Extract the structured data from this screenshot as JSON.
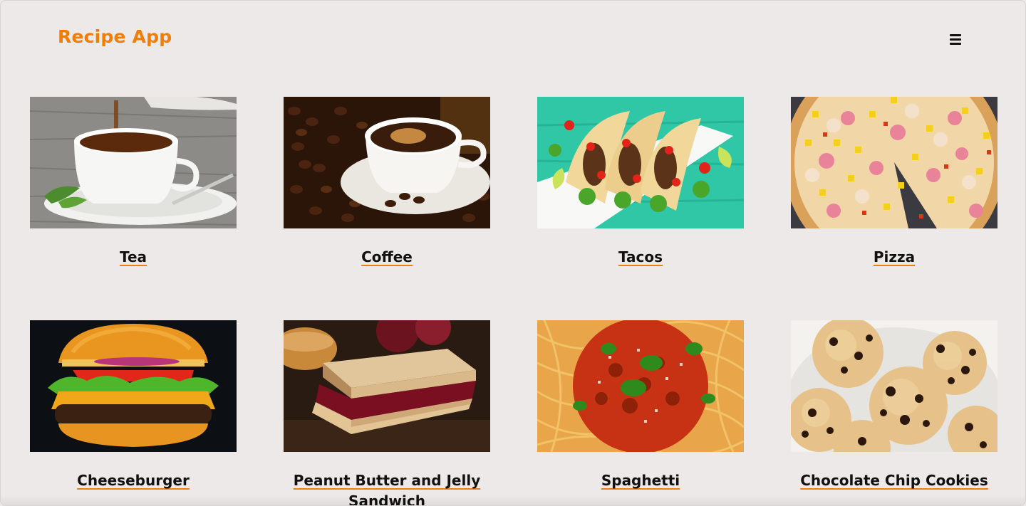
{
  "header": {
    "logo": "Recipe App",
    "menu_icon": "hamburger-menu-icon"
  },
  "recipes": [
    {
      "name": "Tea",
      "image": "tea-cup-photo"
    },
    {
      "name": "Coffee",
      "image": "coffee-cup-photo"
    },
    {
      "name": "Tacos",
      "image": "tacos-photo"
    },
    {
      "name": "Pizza",
      "image": "pizza-photo"
    },
    {
      "name": "Cheeseburger",
      "image": "cheeseburger-photo"
    },
    {
      "name": "Peanut Butter and Jelly Sandwich",
      "image": "pbj-sandwich-photo"
    },
    {
      "name": "Spaghetti",
      "image": "spaghetti-photo"
    },
    {
      "name": "Chocolate Chip Cookies",
      "image": "cookies-photo"
    }
  ],
  "colors": {
    "accent": "#f07d05",
    "background": "#ede9e8",
    "text": "#111111"
  }
}
